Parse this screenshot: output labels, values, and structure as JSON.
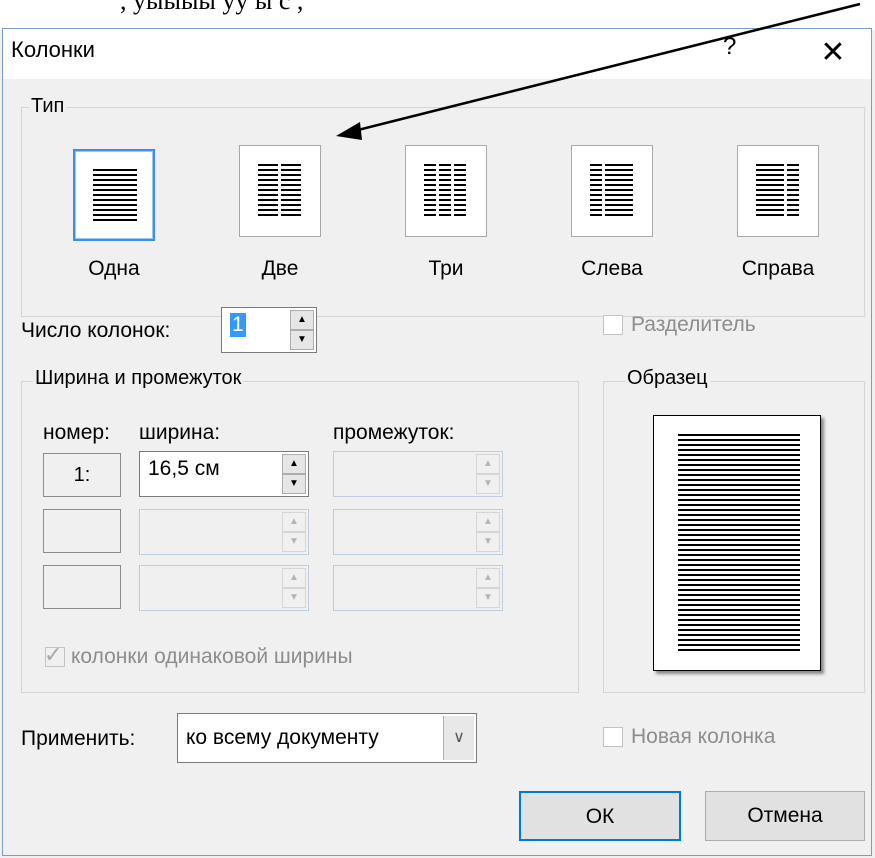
{
  "background_text": ", уыыыы уу ы с ,",
  "dialog": {
    "title": "Колонки",
    "help": "?",
    "close": "✕"
  },
  "type_group": {
    "label": "Тип",
    "options": [
      {
        "label": "Одна",
        "selected": true
      },
      {
        "label": "Две",
        "selected": false
      },
      {
        "label": "Три",
        "selected": false
      },
      {
        "label": "Слева",
        "selected": false
      },
      {
        "label": "Справа",
        "selected": false
      }
    ]
  },
  "num_columns": {
    "label": "Число колонок:",
    "value": "1"
  },
  "separator": {
    "label": "Разделитель",
    "checked": false
  },
  "width_group": {
    "label": "Ширина и промежуток",
    "headers": {
      "number": "номер:",
      "width": "ширина:",
      "spacing": "промежуток:"
    },
    "rows": [
      {
        "number": "1:",
        "width": "16,5 см",
        "spacing": ""
      },
      {
        "number": "",
        "width": "",
        "spacing": ""
      },
      {
        "number": "",
        "width": "",
        "spacing": ""
      }
    ],
    "equal_width": {
      "label": "колонки одинаковой ширины",
      "checked": true
    }
  },
  "preview_group": {
    "label": "Образец"
  },
  "apply": {
    "label": "Применить:",
    "value": "ко всему документу"
  },
  "new_column": {
    "label": "Новая колонка",
    "checked": false
  },
  "buttons": {
    "ok": "ОК",
    "cancel": "Отмена"
  },
  "colors": {
    "accent": "#0078d7",
    "selected_border": "#3c8ee8",
    "disabled_text": "#8d8d8d"
  }
}
